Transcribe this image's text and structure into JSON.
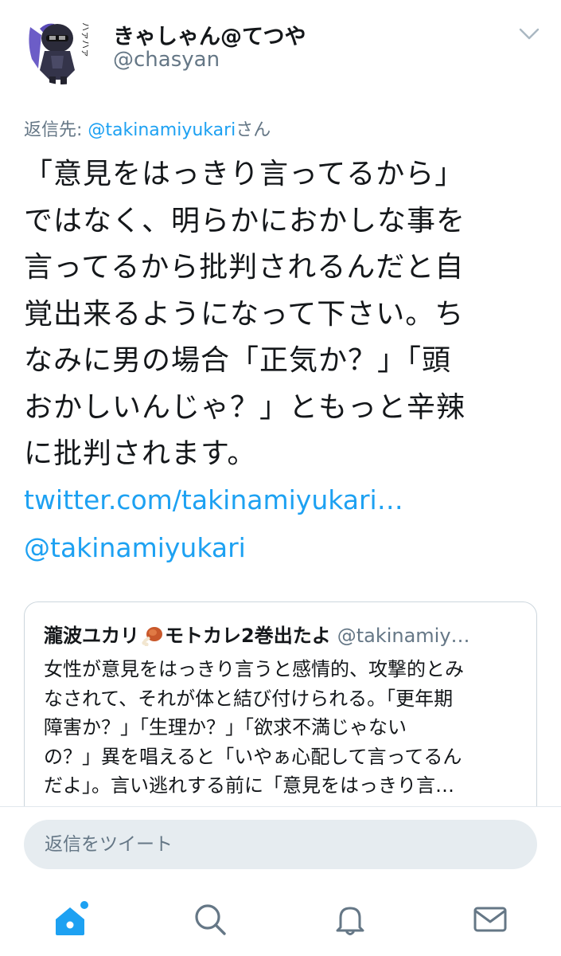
{
  "profile": {
    "display_name": "きゃしゃん@てつや",
    "handle": "@chasyan",
    "avatar_caption": "ハァハァ"
  },
  "reply_context": {
    "prefix": "返信先: ",
    "mention": "@takinamiyukari",
    "suffix": "さん"
  },
  "tweet": {
    "lines": [
      "「意見をはっきり言ってるから」",
      "ではなく、明らかにおかしな事を",
      "言ってるから批判されるんだと自",
      "覚出来るようになって下さい。ち",
      "なみに男の場合「正気か？」「頭",
      "おかしいんじゃ？」ともっと辛辣",
      "に批判されます。"
    ],
    "link_url": "twitter.com/takinamiyukari…",
    "link_mention": "@takinamiyukari"
  },
  "quote": {
    "author_name_part1": "瀧波ユカリ",
    "author_name_part2": "モトカレ2巻出たよ",
    "author_handle": "@takinamiy…",
    "lines": [
      "女性が意見をはっきり言うと感情的、攻撃的とみ",
      "なされて、それが体と結び付けられる。「更年期",
      "障害か？」「生理か？」「欲求不満じゃない",
      "の？」異を唱えると「いやぁ心配して言ってるん",
      "だよ」。言い逃れする前に「意見をはっきり言…"
    ]
  },
  "compose": {
    "placeholder": "返信をツイート"
  },
  "tabs": {
    "home_icon": "home-icon",
    "search_icon": "search-icon",
    "notifications_icon": "bell-icon",
    "messages_icon": "mail-icon"
  },
  "colors": {
    "accent": "#1da1f2",
    "secondary_text": "#657786",
    "primary_text": "#14171a",
    "border": "#ccd6dd",
    "input_bg": "#e6ecf0"
  }
}
